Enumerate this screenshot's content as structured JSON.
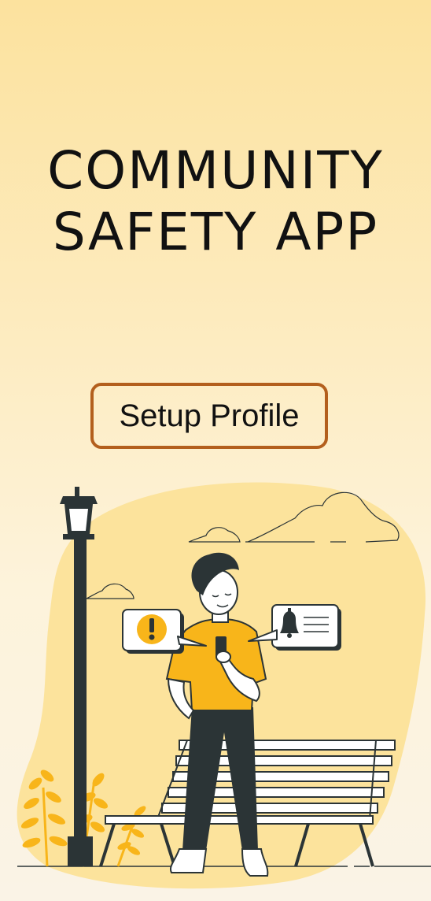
{
  "screen": {
    "title_line1": "COMMUNITY",
    "title_line2": "SAFETY APP",
    "setup_button_label": "Setup Profile"
  },
  "illustration": {
    "alert_bubble_icon": "exclamation-icon",
    "notification_bubble_icon": "bell-icon",
    "colors": {
      "accent_yellow": "#F8B51A",
      "blob": "#FCE39C",
      "dark": "#2B3436",
      "button_border": "#B35F1D"
    }
  }
}
